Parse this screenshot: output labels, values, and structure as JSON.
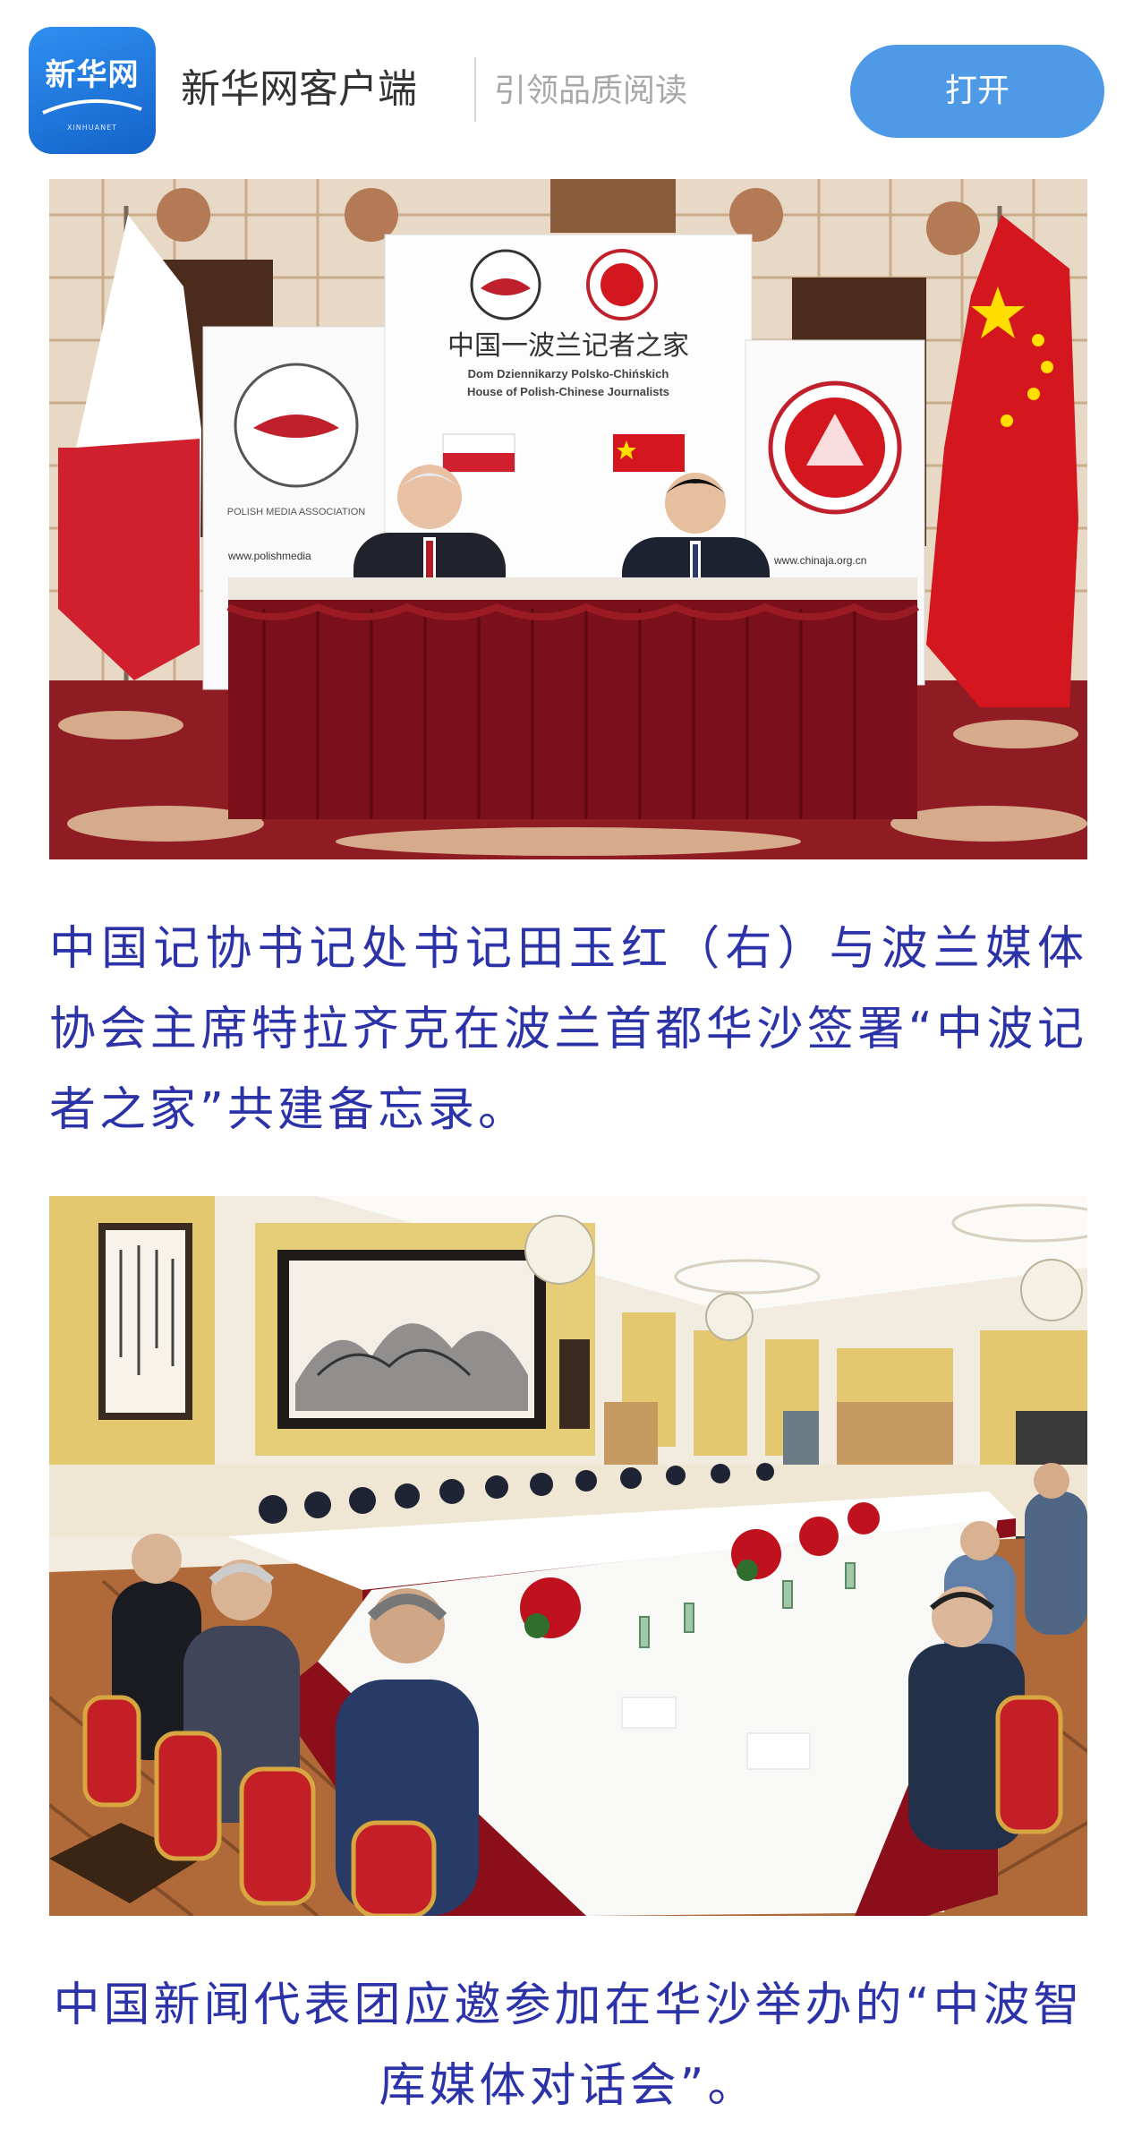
{
  "banner": {
    "logo_text": "新华网",
    "logo_subtext": "XINHUANET",
    "app_name": "新华网客户端",
    "slogan": "引领品质阅读",
    "open_button": "打开",
    "accent_color": "#4e9ae6"
  },
  "article": {
    "photo1": {
      "backdrop_title_cn": "中国一波兰记者之家",
      "backdrop_title_pl": "Dom Dziennikarzy Polsko-Chińskich",
      "backdrop_title_en": "House of Polish-Chinese Journalists",
      "left_banner_text": "POLISH MEDIA ASSOCIATION",
      "left_banner_url": "www.polishmedia",
      "right_banner_url": "www.chinaja.org.cn"
    },
    "caption1": "中国记协书记处书记田玉红（右）与波兰媒体协会主席特拉齐克在波兰首都华沙签署“中波记者之家”共建备忘录。",
    "caption2": "中国新闻代表团应邀参加在华沙举办的“中波智库媒体对话会”。",
    "caption_color": "#2c32a8"
  }
}
